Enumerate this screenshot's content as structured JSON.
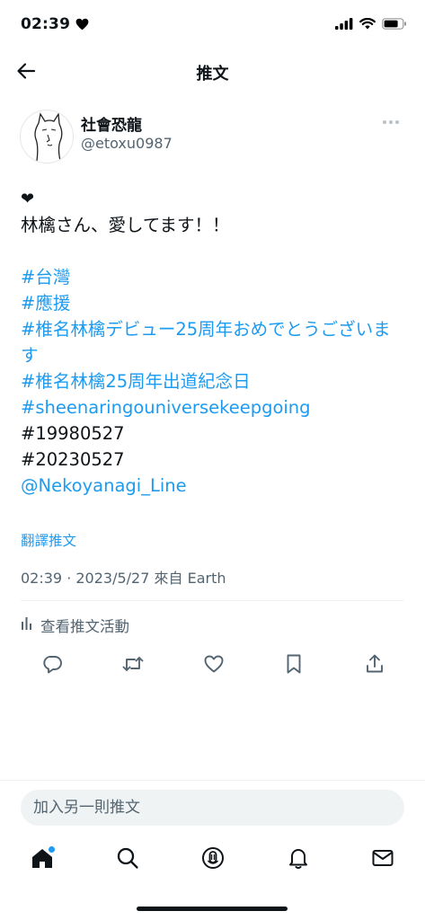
{
  "status_bar": {
    "time": "02:39",
    "time_icon": "heart-icon"
  },
  "header": {
    "title": "推文",
    "back_icon": "back-arrow-icon"
  },
  "tweet": {
    "author": {
      "display_name": "社會恐龍",
      "handle": "@etoxu0987"
    },
    "emoji": "❤",
    "text_line": "林檎さん、愛してます！！",
    "hashtags": [
      "#台灣",
      "#應援",
      "#椎名林檎デビュー25周年おめでとうございます",
      "#椎名林檎25周年出道紀念日",
      "#sheenaringouniversekeepgoing"
    ],
    "plain_tags": [
      "#19980527",
      "#20230527"
    ],
    "mention": "@Nekoyanagi_Line",
    "translate_label": "翻譯推文",
    "timestamp": "02:39 · 2023/5/27 來自 Earth",
    "activity_label": "查看推文活動"
  },
  "reply": {
    "placeholder": "加入另一則推文"
  },
  "colors": {
    "accent": "#1d9bf0",
    "text": "#0f1419",
    "secondary": "#536471",
    "divider": "#eff3f4"
  }
}
